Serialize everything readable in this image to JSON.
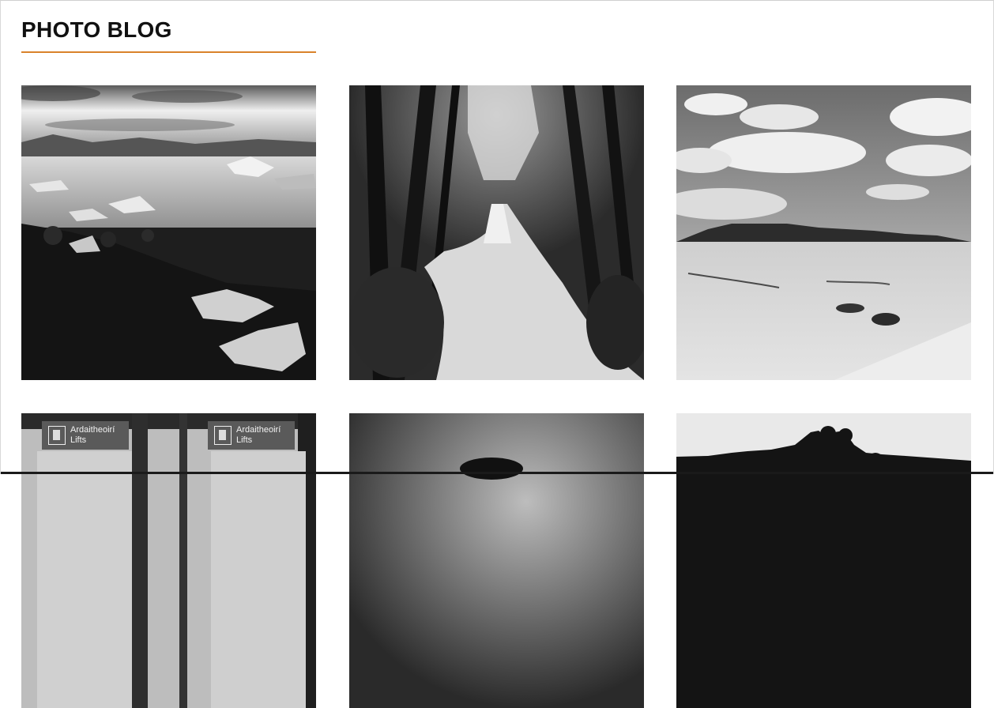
{
  "page": {
    "title": "PHOTO BLOG",
    "accent_color": "#d9822b"
  },
  "photos": [
    {
      "subject": "glacier lagoon with ice on black beach"
    },
    {
      "subject": "forest waterfall"
    },
    {
      "subject": "desert dunes under clouds"
    },
    {
      "subject": "airport lifts signs",
      "signs": [
        {
          "line1": "Ardaitheoirí",
          "line2": "Lifts"
        },
        {
          "line1": "Ardaitheoirí",
          "line2": "Lifts"
        }
      ]
    },
    {
      "subject": "dramatic sky silhouette"
    },
    {
      "subject": "city skyline silhouette with domes"
    }
  ]
}
